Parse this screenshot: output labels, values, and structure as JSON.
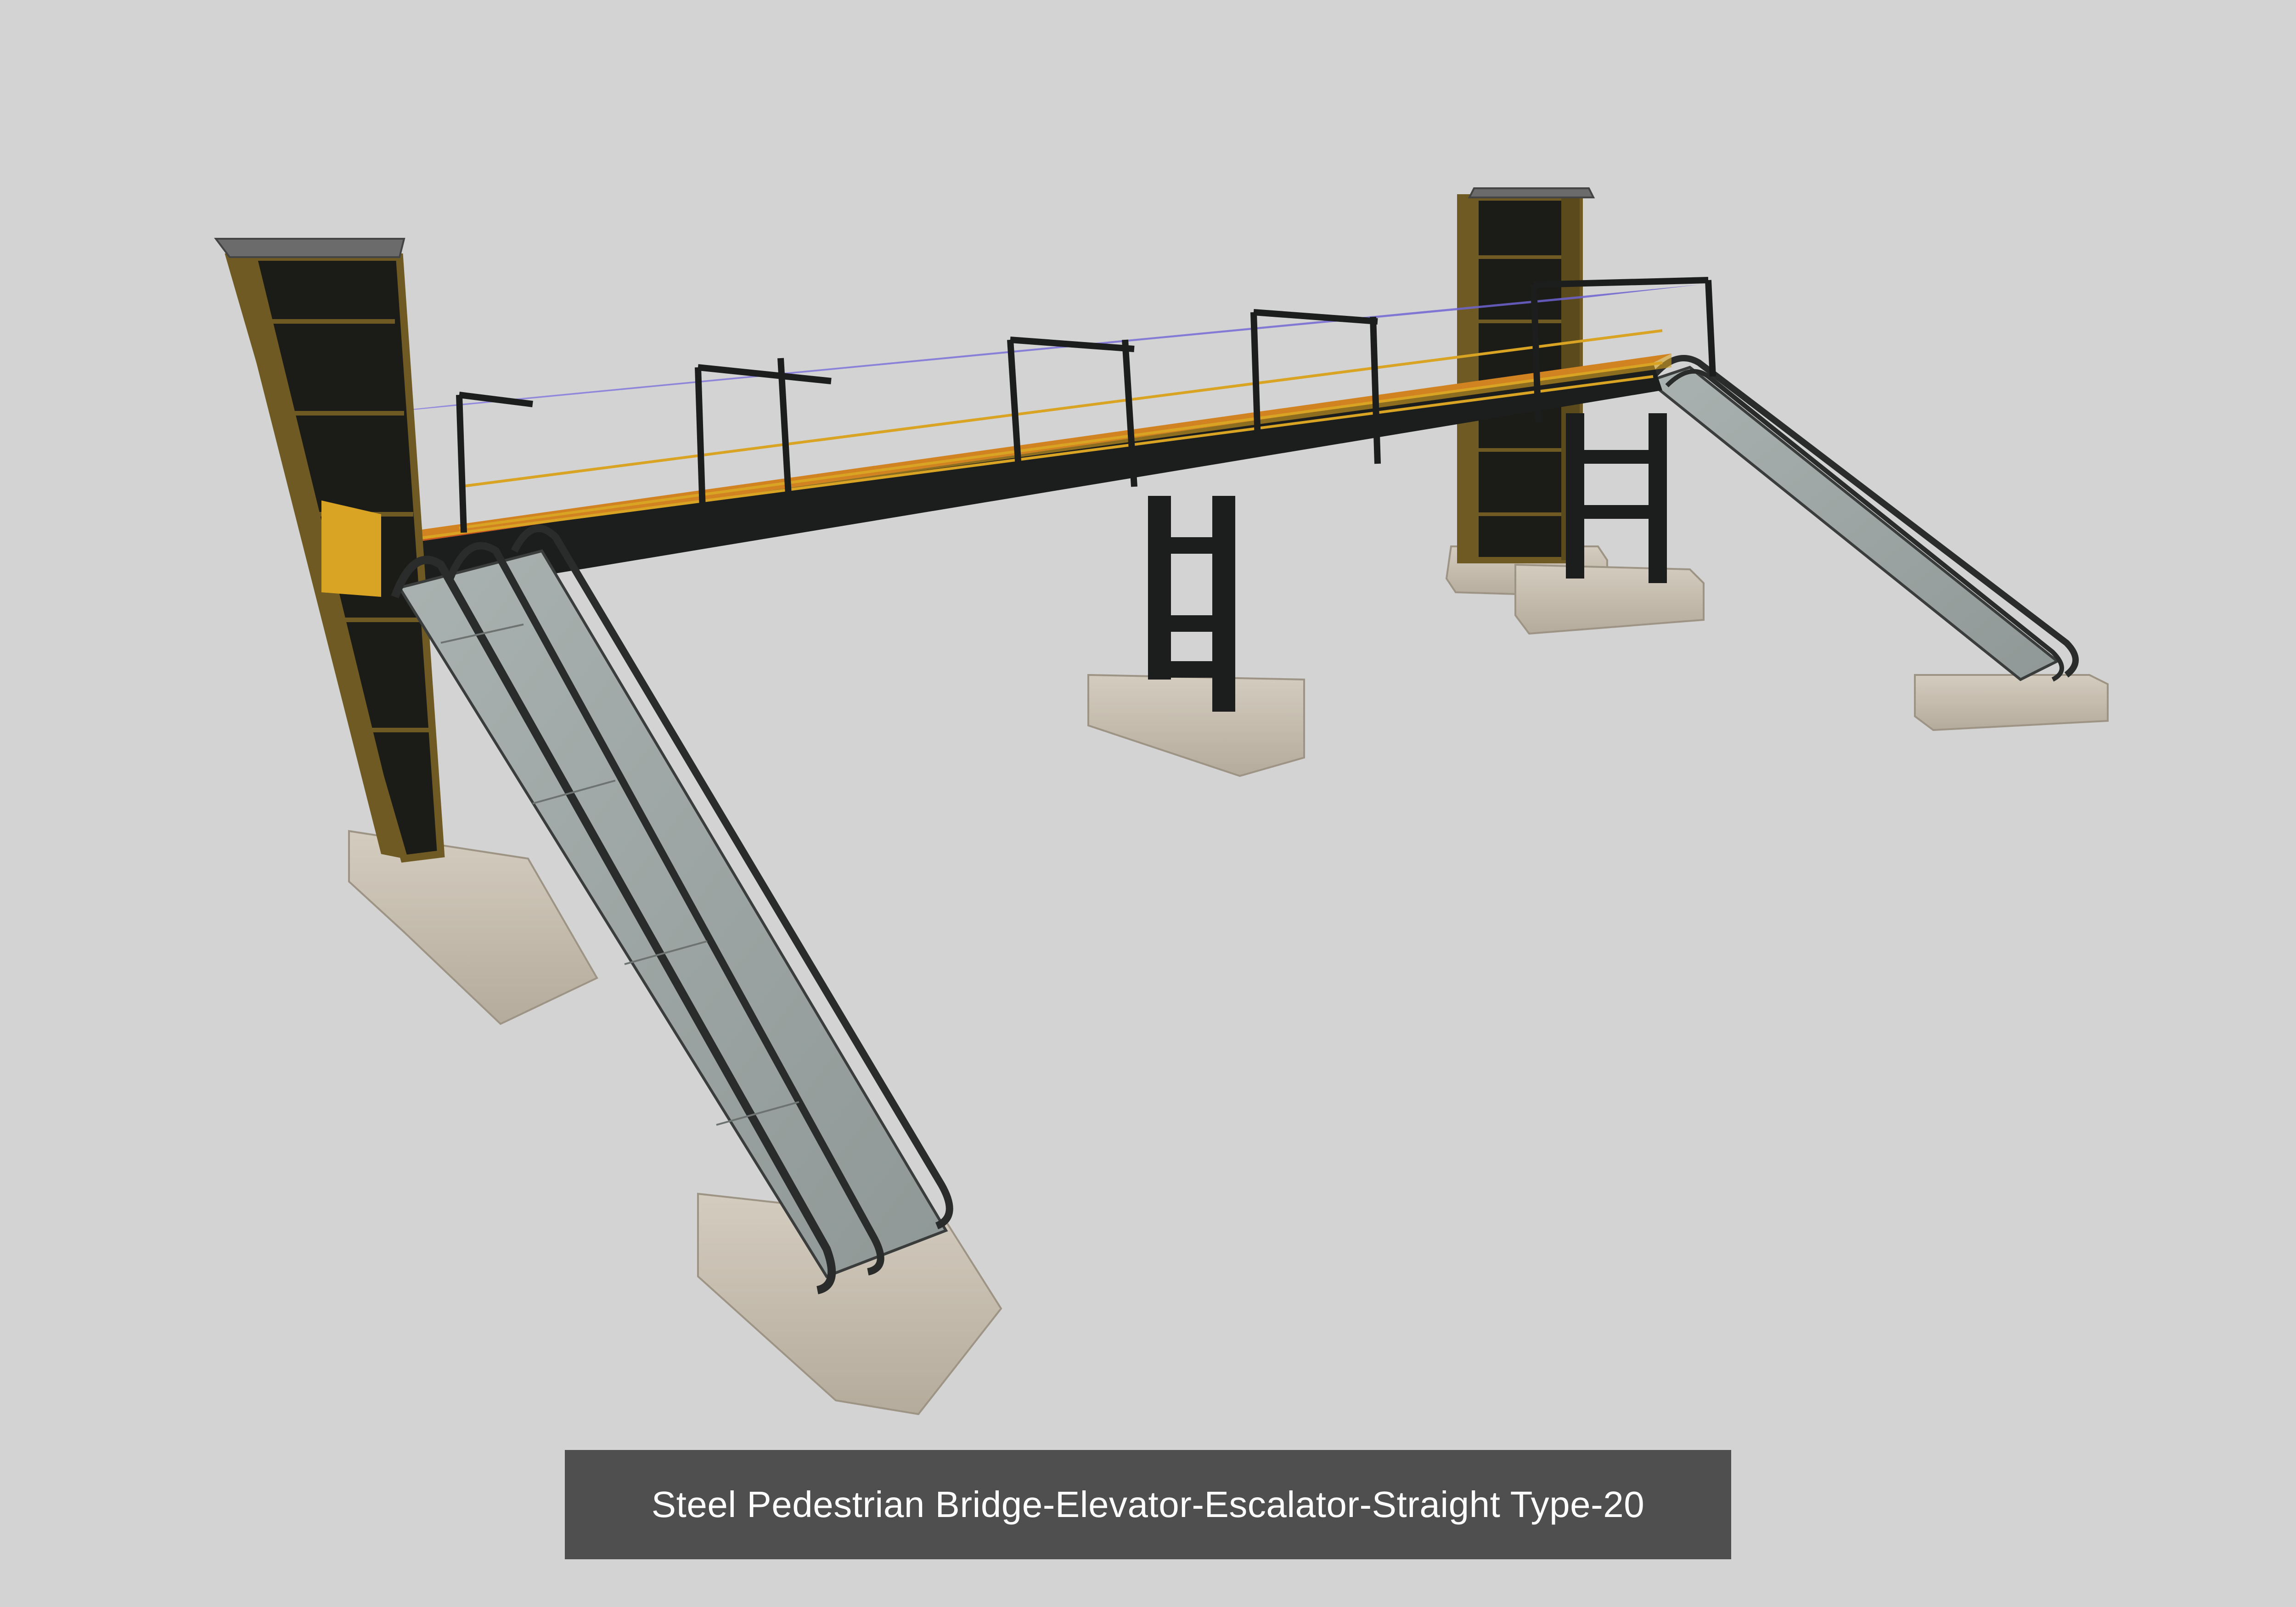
{
  "caption": {
    "text": "Steel Pedestrian Bridge-Elevator-Escalator-Straight Type-20"
  },
  "colors": {
    "background": "#d3d3d3",
    "caption_bar": "#4f4f4f",
    "caption_text": "#ffffff",
    "steel_frame": "#1c1e1d",
    "deck_floor": "#c8531e",
    "railing": "#d9a323",
    "canopy": "#7b6fd6",
    "tower_trim": "#6e5a22",
    "concrete": "#c6bdb0",
    "escalator_glass": "#b8c2c0"
  }
}
